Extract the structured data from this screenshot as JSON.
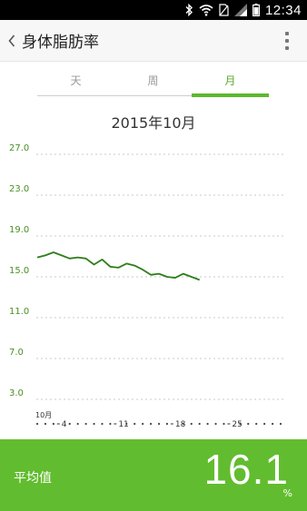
{
  "status_bar": {
    "time": "12:34"
  },
  "header": {
    "title": "身体脂肪率"
  },
  "tabs": [
    {
      "label": "天"
    },
    {
      "label": "周"
    },
    {
      "label": "月",
      "active": true
    }
  ],
  "accent_color": "#5cb82e",
  "panel_color": "#62bc2f",
  "line_color": "#2e7d1a",
  "chart_data": {
    "type": "line",
    "title": "2015年10月",
    "month_label": "10月",
    "yticks": [
      27.0,
      23.0,
      19.0,
      15.0,
      11.0,
      7.0,
      3.0
    ],
    "ylim": [
      3.0,
      27.0
    ],
    "xlim": [
      1,
      31
    ],
    "xtick_labels": [
      {
        "day": 4,
        "label": "4"
      },
      {
        "day": 11,
        "label": "11"
      },
      {
        "day": 18,
        "label": "18"
      },
      {
        "day": 25,
        "label": "25"
      }
    ],
    "grid": true,
    "series": [
      {
        "x": [
          1,
          2,
          3,
          4,
          5,
          6,
          7,
          8,
          9,
          10,
          11,
          12,
          13,
          14,
          15,
          16,
          17,
          18,
          19,
          20,
          21
        ],
        "values": [
          16.9,
          17.1,
          17.4,
          17.1,
          16.8,
          16.9,
          16.8,
          16.2,
          16.7,
          16.0,
          15.9,
          16.3,
          16.1,
          15.7,
          15.2,
          15.3,
          15.0,
          14.9,
          15.3,
          15.0,
          14.7
        ]
      }
    ]
  },
  "summary": {
    "label": "平均值",
    "value": "16.1",
    "unit": "%"
  }
}
